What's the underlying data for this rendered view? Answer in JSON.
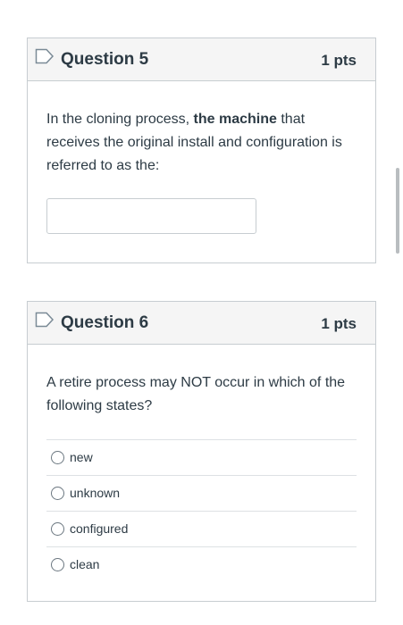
{
  "questions": [
    {
      "title": "Question 5",
      "points": "1 pts",
      "text_before": "In the cloning process, ",
      "text_bold": "the machine",
      "text_after": " that receives the original install and configuration is referred to as the:",
      "answer_value": ""
    },
    {
      "title": "Question 6",
      "points": "1 pts",
      "text": "A retire process may NOT occur in which of the following states?",
      "options": [
        "new",
        "unknown",
        "configured",
        "clean"
      ]
    }
  ],
  "icons": {
    "flag": "flag-outline-icon"
  }
}
